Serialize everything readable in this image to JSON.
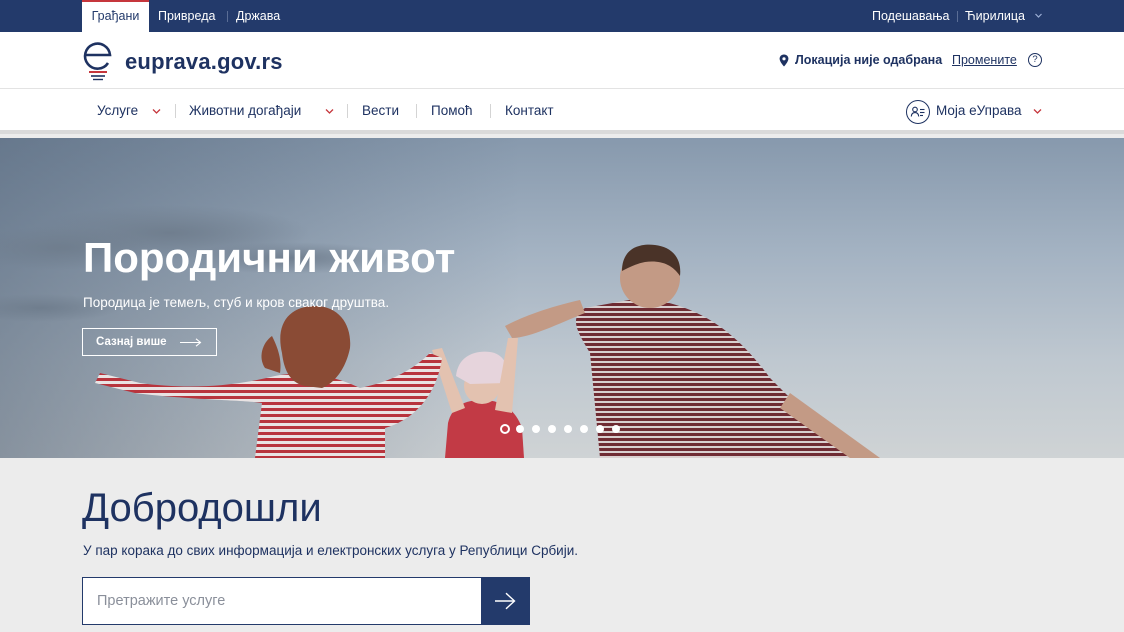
{
  "topbar": {
    "tabs": [
      {
        "label": "Грађани",
        "active": true
      },
      {
        "label": "Привреда",
        "active": false
      },
      {
        "label": "Држава",
        "active": false
      }
    ],
    "settings_label": "Подешавања",
    "script_label": "Ћирилица"
  },
  "header": {
    "logo_text": "euprava.gov.rs",
    "location_text": "Локација није одабрана",
    "location_change": "Промените",
    "help_symbol": "?"
  },
  "nav": {
    "items": [
      {
        "label": "Услуге",
        "has_dropdown": true
      },
      {
        "label": "Животни догађаји",
        "has_dropdown": true
      },
      {
        "label": "Вести",
        "has_dropdown": false
      },
      {
        "label": "Помоћ",
        "has_dropdown": false
      },
      {
        "label": "Контакт",
        "has_dropdown": false
      }
    ],
    "account_label": "Моја еУправа"
  },
  "hero": {
    "title": "Породични живот",
    "subtitle": "Породица је темељ, стуб и кров сваког друштва.",
    "button_label": "Сазнај више",
    "slide_count": 8,
    "active_slide": 1
  },
  "welcome": {
    "title": "Добродошли",
    "subtitle": "У пар корака до свих информација и електронских услуга у Републици Србији.",
    "search_placeholder": "Претражите услуге"
  },
  "icons": {
    "logo": "e-logo-icon",
    "location": "location-pin-icon",
    "help": "help-circle-icon",
    "account": "user-card-icon",
    "arrow": "arrow-right-icon",
    "dropdown": "chevron-down-icon"
  },
  "colors": {
    "primary": "#233a6b",
    "accent": "#c6363c",
    "background": "#ececec"
  }
}
